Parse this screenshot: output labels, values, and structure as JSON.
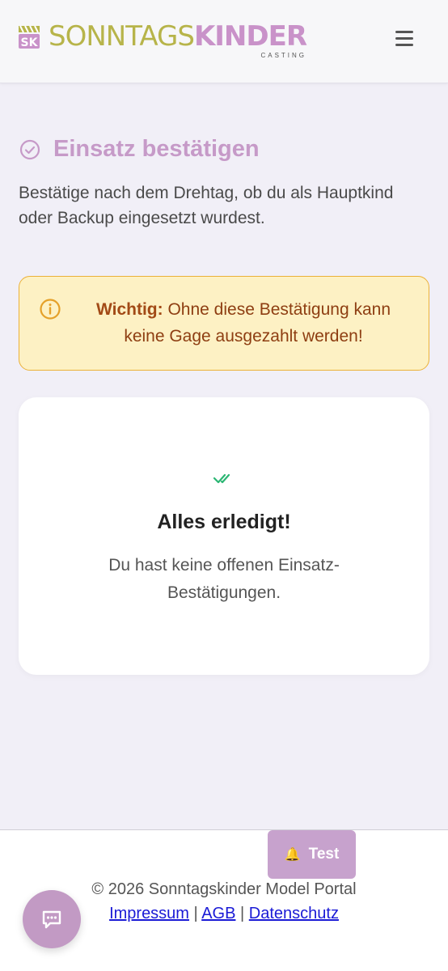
{
  "header": {
    "logo_left": "SONNTAGS",
    "logo_right": "KINDER",
    "logo_sub": "CASTING",
    "menu_icon": "hamburger-menu-icon"
  },
  "page": {
    "title": "Einsatz bestätigen",
    "title_icon": "check-circle-icon",
    "intro": "Bestätige nach dem Drehtag, ob du als Hauptkind oder Backup eingesetzt wurdest."
  },
  "alert": {
    "icon": "info-circle-icon",
    "label": "Wichtig:",
    "text": " Ohne diese Bestätigung kann keine Gage ausgezahlt werden!"
  },
  "empty_state": {
    "icon": "double-check-icon",
    "title": "Alles erledigt!",
    "text": "Du hast keine offenen Einsatz-Bestätigungen."
  },
  "test_button": {
    "label": "Test",
    "icon": "bell-icon"
  },
  "footer": {
    "copyright": "© 2026 Sonntagskinder Model Portal",
    "links": [
      "Impressum",
      "AGB",
      "Datenschutz"
    ],
    "separator": "|"
  },
  "chat_button": {
    "icon": "chat-icon"
  },
  "colors": {
    "brand_olive": "#b7b44a",
    "brand_pink": "#c992c9",
    "alert_bg": "#fdf1c4",
    "alert_border": "#ebb138",
    "success_green": "#2bb673"
  }
}
